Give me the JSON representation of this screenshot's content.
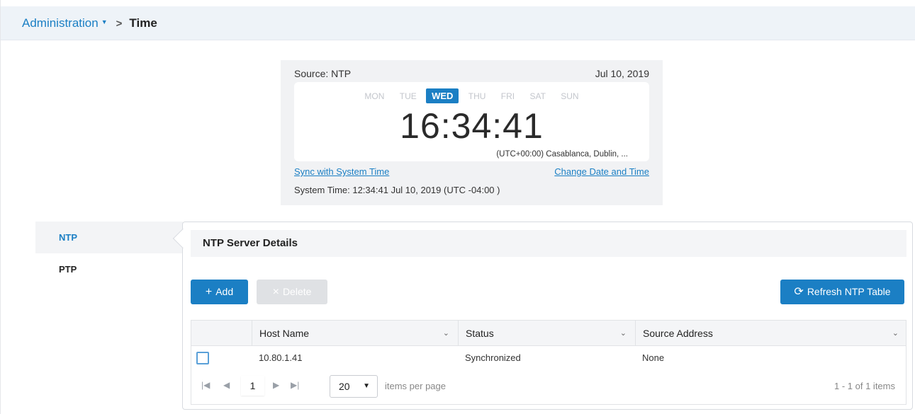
{
  "breadcrumb": {
    "parent": "Administration",
    "current": "Time"
  },
  "clock": {
    "source": "Source: NTP",
    "date": "Jul 10, 2019",
    "days": [
      "MON",
      "TUE",
      "WED",
      "THU",
      "FRI",
      "SAT",
      "SUN"
    ],
    "active_day": "WED",
    "time": "16:34:41",
    "timezone": "(UTC+00:00) Casablanca, Dublin, ...",
    "sync_link": "Sync with System Time",
    "change_link": "Change Date and Time",
    "system_time": "System Time: 12:34:41 Jul 10, 2019 (UTC -04:00 )"
  },
  "tabs": [
    {
      "label": "NTP",
      "active": true
    },
    {
      "label": "PTP",
      "active": false
    }
  ],
  "panel": {
    "title": "NTP Server Details",
    "add_label": "Add",
    "delete_label": "Delete",
    "refresh_label": "Refresh NTP Table"
  },
  "grid": {
    "columns": [
      "Host Name",
      "Status",
      "Source Address"
    ],
    "rows": [
      {
        "host": "10.80.1.41",
        "status": "Synchronized",
        "source": "None"
      }
    ],
    "page": "1",
    "per_page": "20",
    "per_page_label": "items per page",
    "count": "1 - 1 of 1 items"
  },
  "colors": {
    "accent": "#1b7fc4",
    "header_bg": "#eef3f8"
  }
}
